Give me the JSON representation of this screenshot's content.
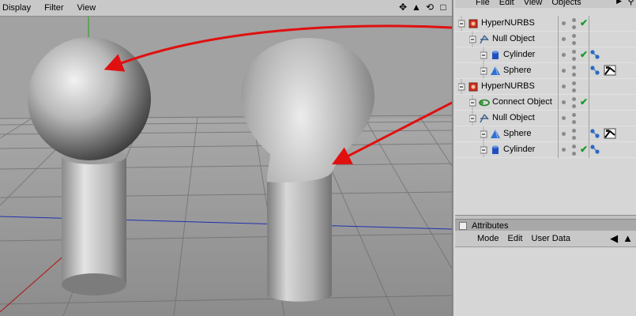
{
  "viewport": {
    "menu": [
      "Display",
      "Filter",
      "View"
    ],
    "tool_icons": [
      "move-icon",
      "camera-icon",
      "rotate-icon",
      "maximize-icon"
    ]
  },
  "object_manager": {
    "menu": [
      "File",
      "Edit",
      "View",
      "Objects"
    ],
    "objects": [
      {
        "name": "HyperNURBS",
        "depth": 0,
        "icon": "hypernurbs-icon",
        "check": true,
        "tags": []
      },
      {
        "name": "Null Object",
        "depth": 1,
        "icon": "null-object-icon",
        "check": false,
        "tags": []
      },
      {
        "name": "Cylinder",
        "depth": 2,
        "icon": "cylinder-icon",
        "check": true,
        "tags": [
          "phong-tag-icon"
        ]
      },
      {
        "name": "Sphere",
        "depth": 2,
        "icon": "sphere-icon",
        "check": false,
        "tags": [
          "phong-tag-icon",
          "texture-tag-icon"
        ]
      },
      {
        "name": "HyperNURBS",
        "depth": 0,
        "icon": "hypernurbs-icon",
        "check": false,
        "tags": []
      },
      {
        "name": "Connect Object",
        "depth": 1,
        "icon": "connect-object-icon",
        "check": true,
        "tags": []
      },
      {
        "name": "Null Object",
        "depth": 1,
        "icon": "null-object-icon",
        "check": false,
        "tags": []
      },
      {
        "name": "Sphere",
        "depth": 2,
        "icon": "sphere-icon",
        "check": false,
        "tags": [
          "phong-tag-icon",
          "texture-tag-icon"
        ]
      },
      {
        "name": "Cylinder",
        "depth": 2,
        "icon": "cylinder-icon",
        "check": true,
        "tags": [
          "phong-tag-icon"
        ]
      }
    ]
  },
  "attributes": {
    "title": "Attributes",
    "menu": [
      "Mode",
      "Edit",
      "User Data"
    ]
  },
  "colors": {
    "annotation_arrow": "#e01010",
    "check": "#1a9a2a",
    "viewport_bg": "#9a9a9a"
  }
}
